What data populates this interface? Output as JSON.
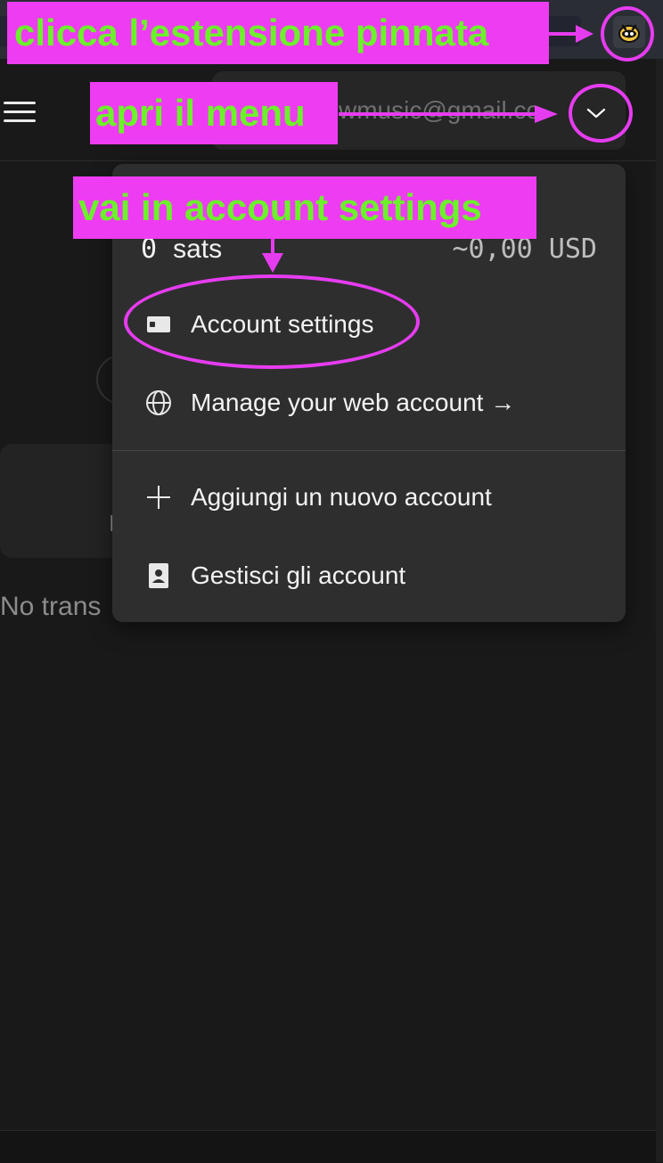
{
  "header": {
    "account_email": "wmusic@gmail.co"
  },
  "balance": {
    "amount": "0",
    "unit": "sats",
    "fiat": "~0,00 USD"
  },
  "menu": {
    "items": [
      {
        "label": "Account settings",
        "icon": "wallet-card-icon"
      },
      {
        "label": "Manage your web account →",
        "icon": "globe-icon"
      },
      {
        "label": "Aggiungi un nuovo account",
        "icon": "plus-icon"
      },
      {
        "label": "Gestisci gli account",
        "icon": "contacts-book-icon"
      }
    ]
  },
  "background": {
    "no_transactions_fragment": "No trans",
    "card_char_fragment": "I"
  },
  "annotations": {
    "step1": "clicca l’estensione pinnata",
    "step2": "apri il menu",
    "step3": "vai in account settings"
  },
  "colors": {
    "annotation_bg": "#ee3cf2",
    "annotation_text": "#6cf22a",
    "popup_bg": "#191919",
    "dropdown_bg": "#2e2e2e"
  }
}
